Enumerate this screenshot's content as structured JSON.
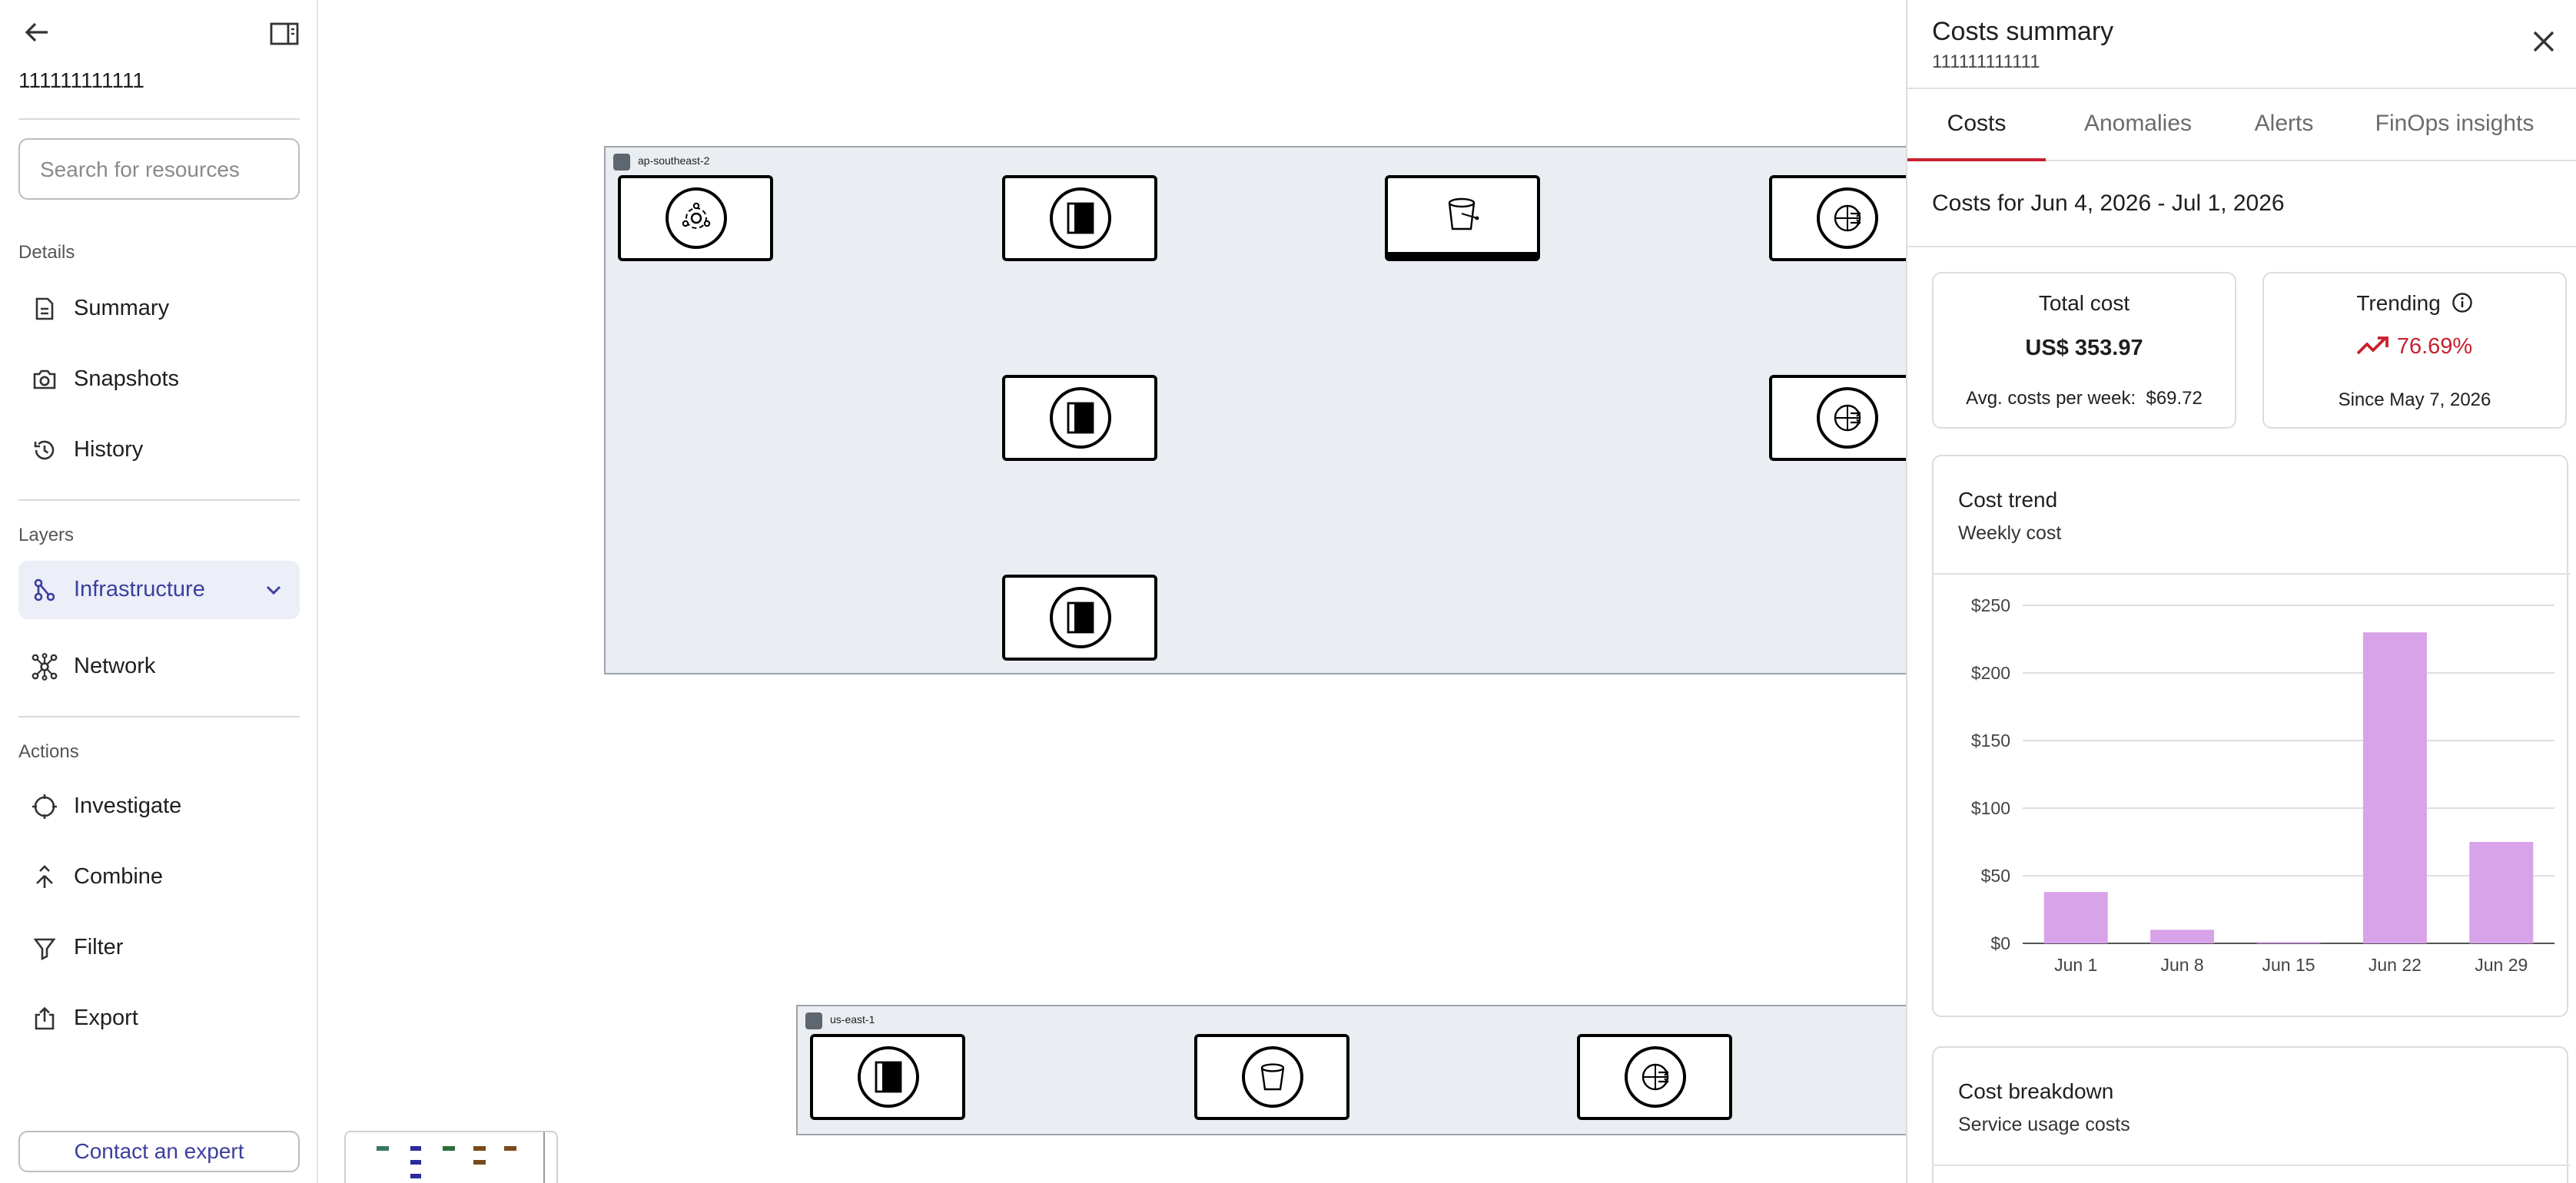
{
  "sidebar": {
    "account_id": "111111111111",
    "search_placeholder": "Search for resources",
    "details_label": "Details",
    "details_items": [
      {
        "label": "Summary",
        "icon": "document-icon"
      },
      {
        "label": "Snapshots",
        "icon": "camera-icon"
      },
      {
        "label": "History",
        "icon": "history-icon"
      }
    ],
    "layers_label": "Layers",
    "layers_items": [
      {
        "label": "Infrastructure",
        "icon": "infrastructure-icon",
        "active": true
      },
      {
        "label": "Network",
        "icon": "network-icon"
      }
    ],
    "actions_label": "Actions",
    "actions_items": [
      {
        "label": "Investigate",
        "icon": "crosshair-icon"
      },
      {
        "label": "Combine",
        "icon": "merge-icon"
      },
      {
        "label": "Filter",
        "icon": "filter-icon"
      },
      {
        "label": "Export",
        "icon": "export-icon"
      }
    ],
    "contact_label": "Contact an expert"
  },
  "canvas": {
    "regions": [
      {
        "name": "ap-southeast-2"
      },
      {
        "name": "us-east-1"
      }
    ]
  },
  "panel": {
    "title": "Costs summary",
    "subtitle": "111111111111",
    "tabs": [
      "Costs",
      "Anomalies",
      "Alerts",
      "FinOps insights"
    ],
    "active_tab": "Costs",
    "date_range": "Costs for Jun 4, 2026 - Jul 1, 2026",
    "total_cost": {
      "title": "Total cost",
      "value": "US$ 353.97",
      "avg_label": "Avg. costs per week:",
      "avg_value": "$69.72"
    },
    "trending": {
      "title": "Trending",
      "value": "76.69%",
      "since": "Since May 7, 2026",
      "color": "#c8202f"
    },
    "cost_trend": {
      "title": "Cost trend",
      "subtitle": "Weekly cost"
    },
    "cost_breakdown": {
      "title": "Cost breakdown",
      "subtitle": "Service usage costs"
    }
  },
  "chart_data": {
    "type": "bar",
    "categories": [
      "Jun 1",
      "Jun 8",
      "Jun 15",
      "Jun 22",
      "Jun 29"
    ],
    "values": [
      38,
      10,
      1,
      230,
      75
    ],
    "ylim": [
      0,
      250
    ],
    "yticks": [
      0,
      50,
      100,
      150,
      200,
      250
    ],
    "ytick_labels": [
      "$0",
      "$50",
      "$100",
      "$150",
      "$200",
      "$250"
    ],
    "bar_color": "#d9a3ea",
    "grid": true
  }
}
